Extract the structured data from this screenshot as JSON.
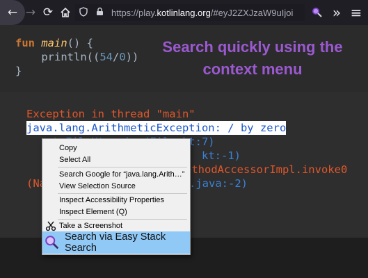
{
  "toolbar": {
    "back_icon": "←",
    "forward_icon": "→",
    "reload_icon": "⟳",
    "home_icon": "⌂",
    "url_prefix": "https://play.",
    "url_host": "kotlinlang.org",
    "url_rest": "/#eyJ2ZXJzaW9uIjoi",
    "more_icon": "»",
    "menu_icon": "≡"
  },
  "editor": {
    "line1_kw": "fun",
    "line1_fn": "main",
    "line1_rest": "() {",
    "line2_pre": "    println((",
    "line2_num1": "54",
    "line2_op": "/",
    "line2_num2": "0",
    "line2_post": "))",
    "line3": "}"
  },
  "overlay": {
    "title_line1": "Search quickly using the",
    "title_line2": "context menu"
  },
  "output": {
    "line1": "Exception in thread \"main\"",
    "line2_selected": "java.lang.ArithmeticException: / by zero",
    "line3": "   at FileKt.main (File.kt:7)",
    "line4_tail": "kt:-1)",
    "line5_tail": "ethodAccessorImpl.invoke0",
    "line6_start": "(Na",
    "line6_tail": ".java:-2)"
  },
  "context_menu": {
    "copy": "Copy",
    "select_all": "Select All",
    "search_google": "Search Google for “java.lang.Arith…”",
    "view_source": "View Selection Source",
    "inspect_accessibility": "Inspect Accessibility Properties",
    "inspect_element": "Inspect Element (Q)",
    "screenshot": "Take a Screenshot",
    "easy_stack_search": "Search via Easy Stack Search"
  },
  "colors": {
    "accent_purple": "#9b59d0",
    "error_orange": "#e0572b",
    "highlight_blue": "#90c8f6"
  }
}
